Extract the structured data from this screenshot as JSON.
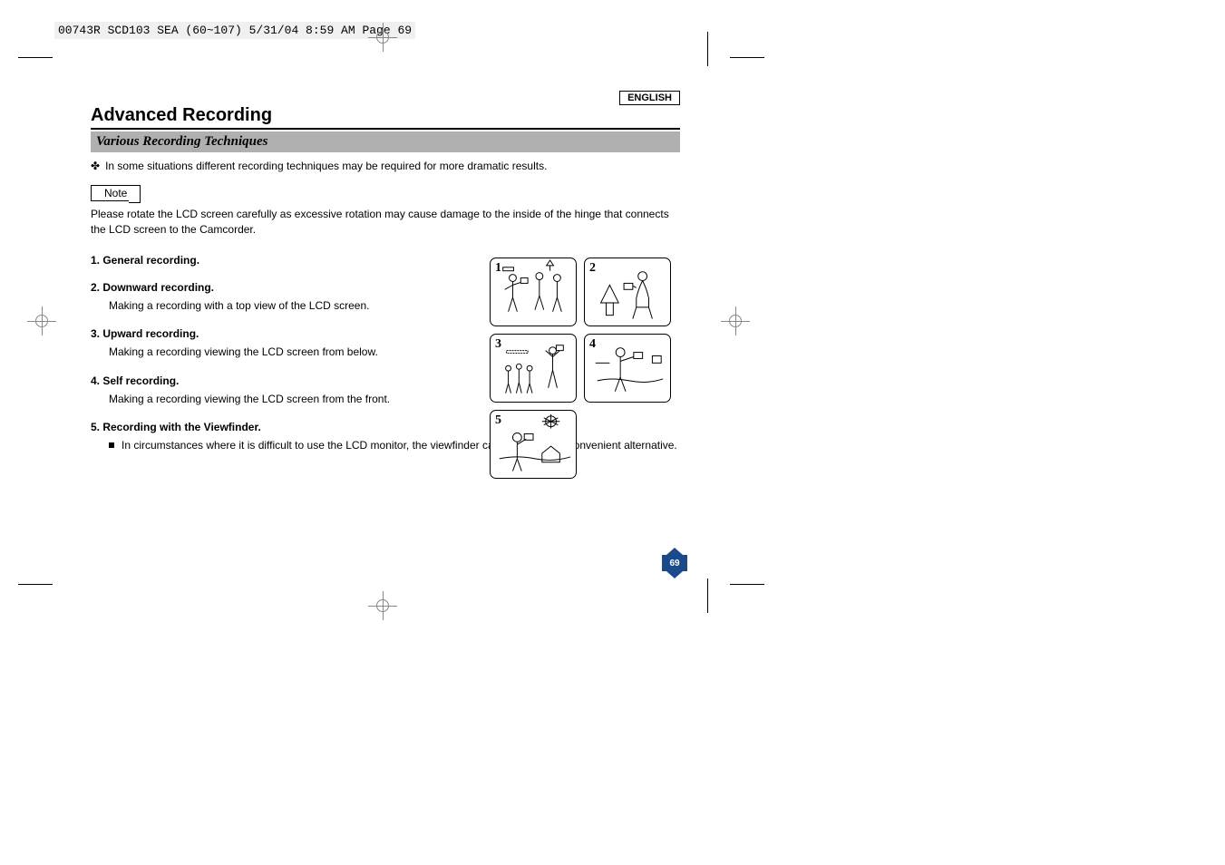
{
  "header_slug": "00743R SCD103 SEA (60~107)  5/31/04 8:59 AM  Page 69",
  "language_box": "ENGLISH",
  "main_title": "Advanced Recording",
  "subtitle": "Various Recording Techniques",
  "intro_bullet": "✤",
  "intro_text": "In some situations different recording techniques may be required for more dramatic results.",
  "note_label": "Note",
  "note_text": "Please rotate the LCD screen carefully as excessive rotation may cause damage to the inside of the hinge that connects the LCD screen to the Camcorder.",
  "techniques": [
    {
      "title": "1.  General recording.",
      "desc": ""
    },
    {
      "title": "2.  Downward recording.",
      "desc": "Making a recording with a top view of the LCD screen."
    },
    {
      "title": "3.  Upward recording.",
      "desc": "Making a recording viewing the LCD screen from below."
    },
    {
      "title": "4.  Self recording.",
      "desc": "Making a recording viewing the LCD screen from the front."
    },
    {
      "title": "5.  Recording with the Viewfinder.",
      "desc": "In circumstances where it is difficult to use the LCD monitor, the viewfinder can be used as a convenient alternative."
    }
  ],
  "illus_numbers": [
    "1",
    "2",
    "3",
    "4",
    "5"
  ],
  "page_number": "69"
}
